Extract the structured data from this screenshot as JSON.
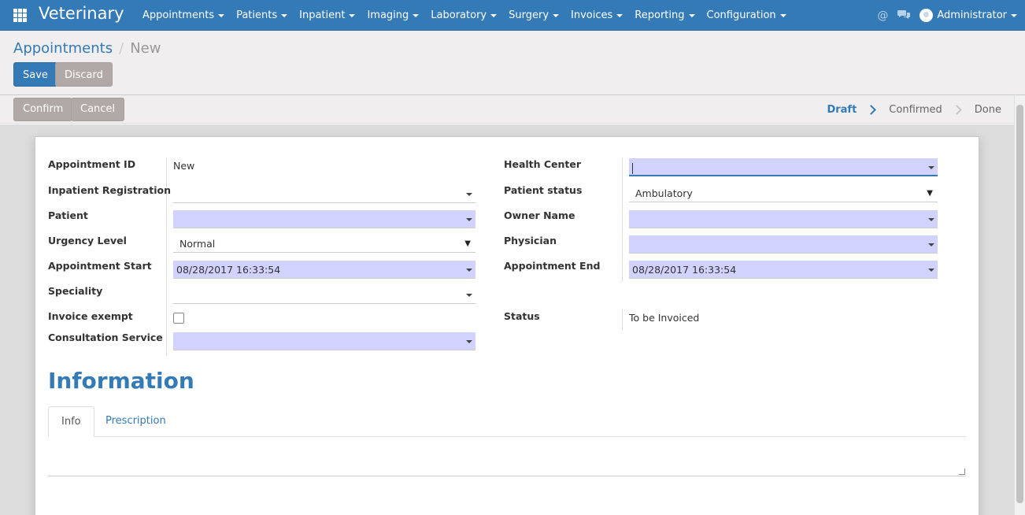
{
  "navbar": {
    "brand": "Veterinary",
    "menu": [
      "Appointments",
      "Patients",
      "Inpatient",
      "Imaging",
      "Laboratory",
      "Surgery",
      "Invoices",
      "Reporting",
      "Configuration"
    ],
    "mention_icon": "@",
    "chat_icon": "chat-icon",
    "user": "Administrator"
  },
  "breadcrumb": {
    "parent": "Appointments",
    "separator": "/",
    "current": "New"
  },
  "buttons": {
    "save": "Save",
    "discard": "Discard",
    "confirm": "Confirm",
    "cancel": "Cancel"
  },
  "statusbar": {
    "steps": [
      "Draft",
      "Confirmed",
      "Done"
    ],
    "active": "Draft"
  },
  "form": {
    "left": {
      "appointment_id": {
        "label": "Appointment ID",
        "value": "New"
      },
      "inpatient_registration": {
        "label": "Inpatient Registration",
        "value": ""
      },
      "patient": {
        "label": "Patient",
        "value": ""
      },
      "urgency_level": {
        "label": "Urgency Level",
        "value": "Normal"
      },
      "appointment_start": {
        "label": "Appointment Start",
        "value": "08/28/2017 16:33:54"
      },
      "speciality": {
        "label": "Speciality",
        "value": ""
      },
      "invoice_exempt": {
        "label": "Invoice exempt",
        "checked": false
      },
      "consultation_service": {
        "label": "Consultation Service",
        "value": ""
      }
    },
    "right": {
      "health_center": {
        "label": "Health Center",
        "value": ""
      },
      "patient_status": {
        "label": "Patient status",
        "value": "Ambulatory"
      },
      "owner_name": {
        "label": "Owner Name",
        "value": ""
      },
      "physician": {
        "label": "Physician",
        "value": ""
      },
      "appointment_end": {
        "label": "Appointment End",
        "value": "08/28/2017 16:33:54"
      },
      "status": {
        "label": "Status",
        "value": "To be Invoiced"
      }
    }
  },
  "information": {
    "title": "Information",
    "tabs": [
      "Info",
      "Prescription"
    ],
    "active_tab": "Info"
  },
  "colors": {
    "primary": "#337ab7",
    "required": "#d2d2ff",
    "secondary_button": "#b1a9a7"
  }
}
